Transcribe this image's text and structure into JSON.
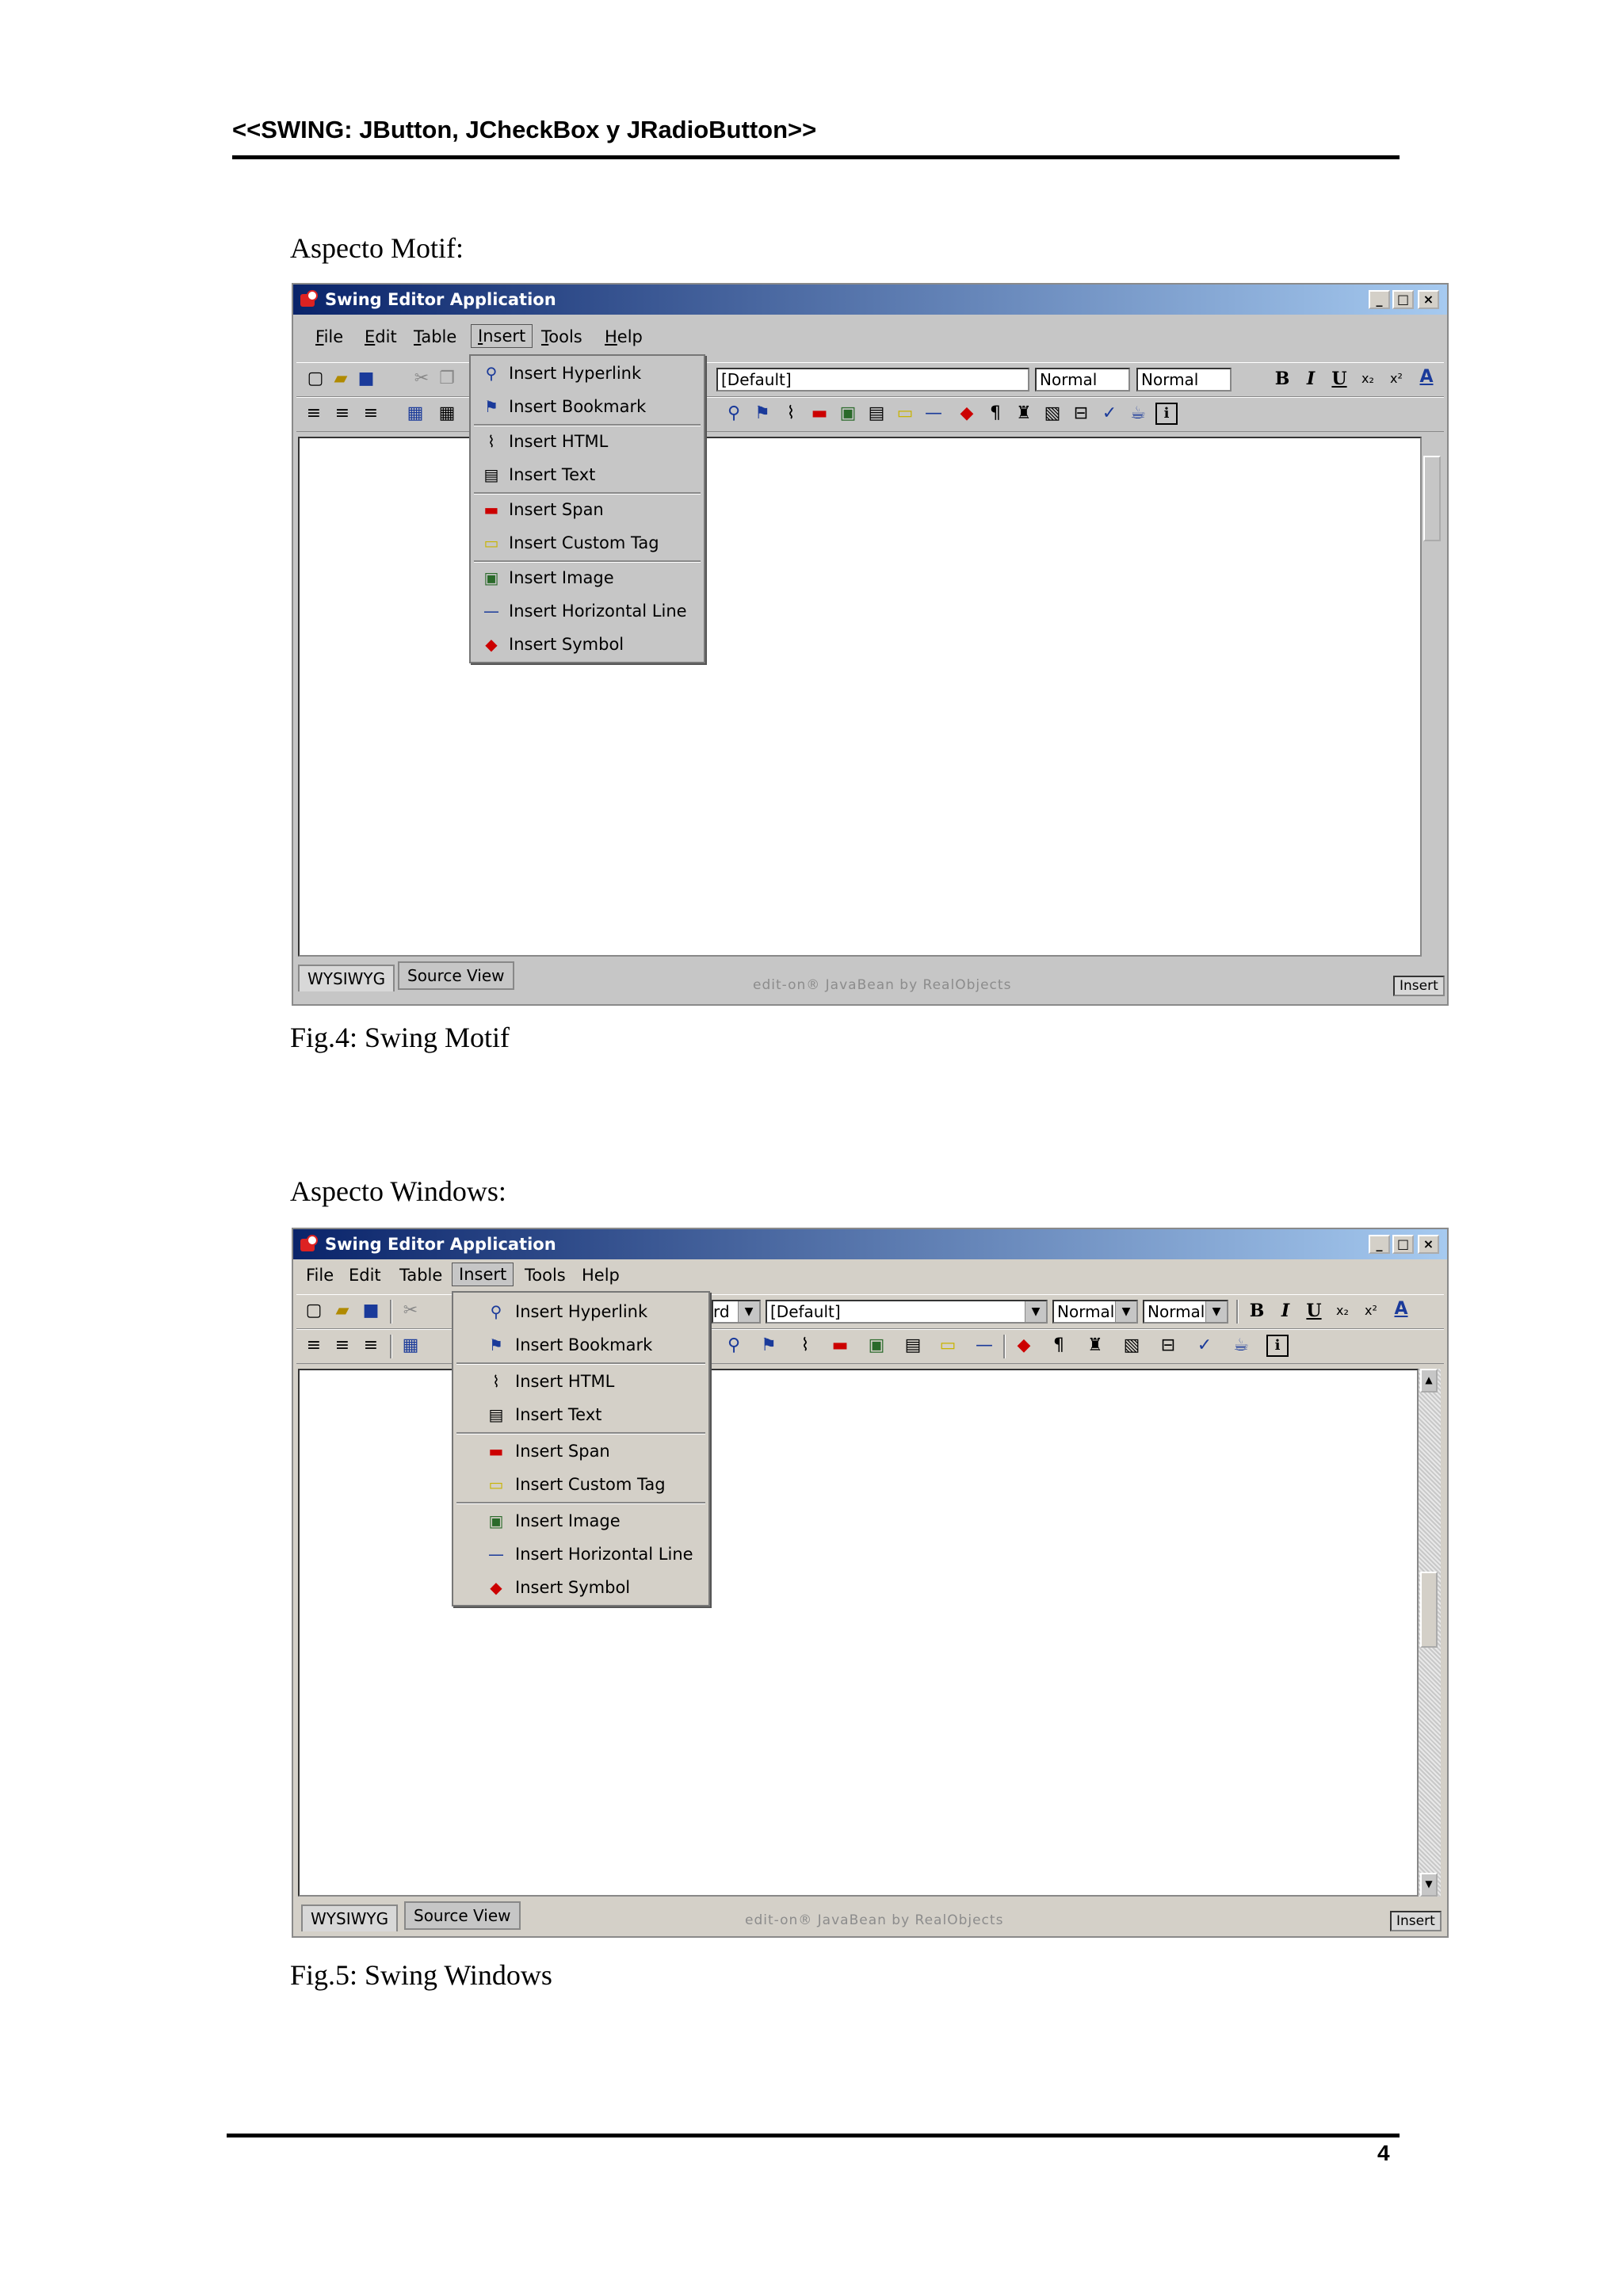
{
  "header": {
    "title": "<<SWING: JButton, JCheckBox y JRadioButton>>"
  },
  "page_number": "4",
  "fig4": {
    "heading": "Aspecto Motif:",
    "caption": "Fig.4: Swing Motif",
    "window_title": "Swing Editor Application",
    "menus": [
      "File",
      "Edit",
      "Table",
      "Insert",
      "Tools",
      "Help"
    ],
    "combo_style": "[Default]",
    "combo_size1": "Normal",
    "combo_size2": "Normal",
    "tabs": [
      "WYSIWYG",
      "Source View"
    ],
    "brand": "edit-on® JavaBean by RealObjects",
    "mode": "Insert"
  },
  "fig5": {
    "heading": "Aspecto Windows:",
    "caption": "Fig.5: Swing Windows",
    "window_title": "Swing Editor Application",
    "menus": [
      "File",
      "Edit",
      "Table",
      "Insert",
      "Tools",
      "Help"
    ],
    "combo_partial": "rd",
    "combo_style": "[Default]",
    "combo_size1": "Normal",
    "combo_size2": "Normal",
    "tabs": [
      "WYSIWYG",
      "Source View"
    ],
    "brand": "edit-on® JavaBean by RealObjects",
    "mode": "Insert"
  },
  "insert_menu": [
    {
      "label": "Insert Hyperlink",
      "icon": "hyperlink-icon"
    },
    {
      "label": "Insert Bookmark",
      "icon": "bookmark-icon"
    },
    {
      "label": "Insert HTML",
      "icon": "paperclip-icon"
    },
    {
      "label": "Insert Text",
      "icon": "text-document-icon"
    },
    {
      "label": "Insert Span",
      "icon": "span-tag-icon"
    },
    {
      "label": "Insert Custom Tag",
      "icon": "custom-tag-icon"
    },
    {
      "label": "Insert Image",
      "icon": "image-icon"
    },
    {
      "label": "Insert Horizontal Line",
      "icon": "horizontal-line-icon"
    },
    {
      "label": "Insert Symbol",
      "icon": "symbol-icon"
    }
  ],
  "icons": {
    "cut": "✂",
    "bold": "B",
    "italic": "I",
    "underline": "U",
    "subscript": "x₂",
    "superscript": "x²",
    "font_color": "A",
    "pilcrow": "¶",
    "info": "i"
  }
}
